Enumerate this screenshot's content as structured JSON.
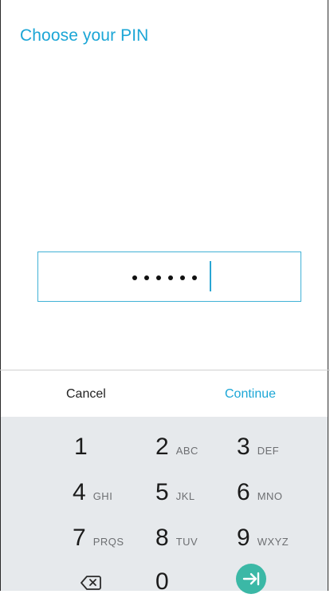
{
  "header": {
    "title": "Choose your PIN"
  },
  "pin": {
    "masked_length": 6
  },
  "actions": {
    "cancel_label": "Cancel",
    "continue_label": "Continue"
  },
  "keypad": {
    "keys": [
      {
        "digit": "1",
        "letters": ""
      },
      {
        "digit": "2",
        "letters": "ABC"
      },
      {
        "digit": "3",
        "letters": "DEF"
      },
      {
        "digit": "4",
        "letters": "GHI"
      },
      {
        "digit": "5",
        "letters": "JKL"
      },
      {
        "digit": "6",
        "letters": "MNO"
      },
      {
        "digit": "7",
        "letters": "PRQS"
      },
      {
        "digit": "8",
        "letters": "TUV"
      },
      {
        "digit": "9",
        "letters": "WXYZ"
      },
      {
        "digit": "0",
        "letters": ""
      }
    ],
    "backspace_icon": "backspace-icon",
    "enter_icon": "enter-icon"
  },
  "colors": {
    "accent": "#1ba6d6",
    "keypad_bg": "#e6e9ec",
    "enter_button": "#3bb8a6"
  }
}
